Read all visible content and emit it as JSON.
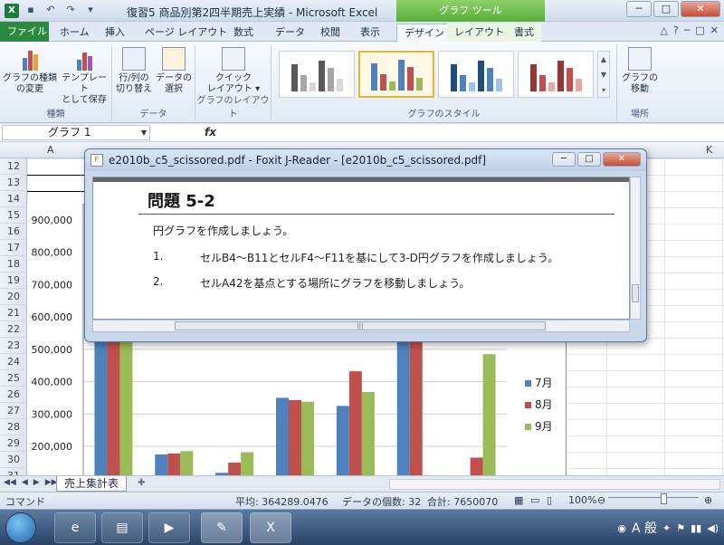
{
  "excel": {
    "app_icon": "X",
    "title": "復習5  商品別第2四半期売上実績  -  Microsoft Excel",
    "context_tab_label": "グラフ ツール",
    "window_buttons": {
      "minimize": "─",
      "maximize": "□",
      "close": "✕"
    },
    "tabs": [
      {
        "label": "ファイル"
      },
      {
        "label": "ホーム"
      },
      {
        "label": "挿入"
      },
      {
        "label": "ページ レイアウト"
      },
      {
        "label": "数式"
      },
      {
        "label": "データ"
      },
      {
        "label": "校閲"
      },
      {
        "label": "表示"
      },
      {
        "label": "デザイン"
      },
      {
        "label": "レイアウト"
      },
      {
        "label": "書式"
      }
    ],
    "ribbon": {
      "type_group": {
        "label": "種類",
        "change_type": "グラフの種類\nの変更",
        "save_template": "テンプレート\nとして保存"
      },
      "data_group": {
        "label": "データ",
        "switch_row_col": "行/列の\n切り替え",
        "select_data": "データの\n選択"
      },
      "layout_group": {
        "label": "グラフのレイアウト",
        "quick_layout": "クイック\nレイアウト ▾"
      },
      "styles_group": {
        "label": "グラフのスタイル"
      },
      "location_group": {
        "label": "場所",
        "move_chart": "グラフの\n移動"
      }
    },
    "name_box": "グラフ 1",
    "fx_label": "fx",
    "column_header": "A",
    "column_header_right": "K",
    "rows": [
      "12",
      "13",
      "14",
      "15",
      "16",
      "17",
      "18",
      "19",
      "20",
      "21",
      "22",
      "23",
      "24",
      "25",
      "26",
      "27",
      "28",
      "29",
      "30",
      "31"
    ],
    "sheet_tab": "売上集計表",
    "status": {
      "mode": "コマンド",
      "average": "平均: 364289.0476",
      "count": "データの個数: 32",
      "sum": "合計: 7650070",
      "zoom": "100%"
    }
  },
  "chart_data": {
    "type": "bar",
    "yticks": [
      "900,000",
      "800,000",
      "700,000",
      "600,000",
      "500,000",
      "400,000",
      "300,000",
      "200,000"
    ],
    "ylim": [
      100000,
      900000
    ],
    "categories": [
      "",
      "",
      "",
      "",
      "",
      "",
      ""
    ],
    "series": [
      {
        "name": "7月",
        "color": "#4f81bd",
        "values": [
          600000,
          175000,
          118000,
          350000,
          325000,
          600000,
          0
        ]
      },
      {
        "name": "8月",
        "color": "#c0504d",
        "values": [
          600000,
          178000,
          150000,
          343000,
          432000,
          600000,
          165000
        ]
      },
      {
        "name": "9月",
        "color": "#9bbb59",
        "values": [
          600000,
          185000,
          182000,
          338000,
          368000,
          0,
          485000
        ]
      }
    ]
  },
  "foxit": {
    "icon": "F",
    "title": "e2010b_c5_scissored.pdf - Foxit J-Reader - [e2010b_c5_scissored.pdf]",
    "window_buttons": {
      "minimize": "─",
      "maximize": "□",
      "close": "✕"
    },
    "heading": "問題 5-2",
    "intro": "円グラフを作成しましょう。",
    "items": [
      {
        "num": "1.",
        "text": "セルB4～B11とセルF4～F11を基にして3-D円グラフを作成しましょう。"
      },
      {
        "num": "2.",
        "text": "セルA42を基点とする場所にグラフを移動しましょう。"
      }
    ]
  },
  "taskbar": {
    "apps": [
      "ie-icon",
      "explorer-icon",
      "media-player-icon",
      "foxit-icon",
      "excel-icon"
    ],
    "ime": "A 般"
  }
}
